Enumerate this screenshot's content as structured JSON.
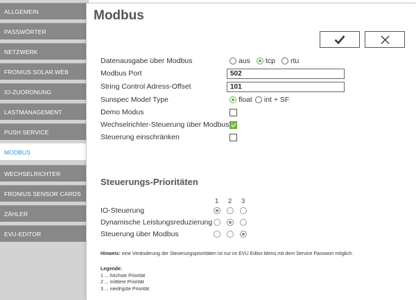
{
  "sidebar": {
    "items": [
      {
        "label": "ALLGEMEIN"
      },
      {
        "label": "PASSWÖRTER"
      },
      {
        "label": "NETZWERK"
      },
      {
        "label": "FRONIUS SOLAR.WEB"
      },
      {
        "label": "IO-ZUORDNUNG"
      },
      {
        "label": "LASTMANAGEMENT"
      },
      {
        "label": "PUSH SERVICE"
      },
      {
        "label": "MODBUS"
      },
      {
        "label": "WECHSELRICHTER"
      },
      {
        "label": "FRONIUS SENSOR CARDS"
      },
      {
        "label": "ZÄHLER"
      },
      {
        "label": "EVU-EDITOR"
      }
    ],
    "active": "MODBUS"
  },
  "page": {
    "title": "Modbus"
  },
  "toolbar": {
    "ok_icon": "checkmark-icon",
    "cancel_icon": "close-icon"
  },
  "form": {
    "datenausgabe_label": "Datenausgabe über Modbus",
    "datenausgabe_options": [
      "aus",
      "tcp",
      "rtu"
    ],
    "datenausgabe_selected": "tcp",
    "port_label": "Modbus Port",
    "port_value": "502",
    "offset_label": "String Control Adress-Offset",
    "offset_value": "101",
    "sunspec_label": "Sunspec Model Type",
    "sunspec_options": [
      "float",
      "int + SF"
    ],
    "sunspec_selected": "float",
    "demo_label": "Demo Modus",
    "demo_checked": false,
    "wr_label": "Wechselrichter-Steuerung über Modbus",
    "wr_checked": true,
    "restrict_label": "Steuerung einschränken",
    "restrict_checked": false
  },
  "priorities": {
    "title": "Steuerungs-Prioritäten",
    "columns": [
      "1",
      "2",
      "3"
    ],
    "rows": [
      {
        "label": "IO-Steuerung",
        "selected": 1
      },
      {
        "label": "Dynamische Leistungsreduzierung",
        "selected": 2
      },
      {
        "label": "Steuerung über Modbus",
        "selected": 3
      }
    ]
  },
  "hint": {
    "bold": "Hinweis:",
    "text": " eine Veränderung der Steuerungsprioritäten ist nur im EVU Editor Menü mit dem Service Passwort möglich."
  },
  "legend": {
    "title": "Legende:",
    "items": [
      "1 ... höchste Priorität",
      "2 ... mittlere Priorität",
      "3 ... niedrigste Priorität"
    ]
  },
  "colors": {
    "sidebar_item": "#888888",
    "active_text": "#2a93d5",
    "checkbox_on": "#7cb84a",
    "radio_on": "#6ab04c"
  }
}
